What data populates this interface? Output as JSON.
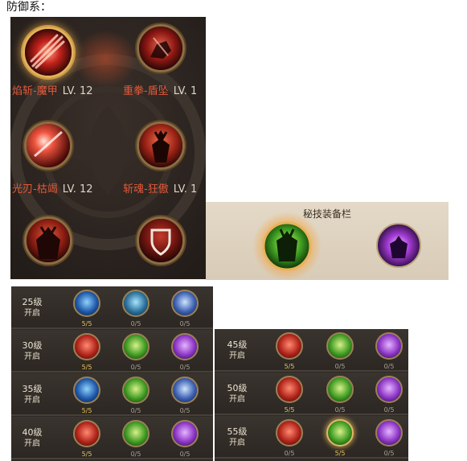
{
  "heading": "防御系：",
  "skills": [
    {
      "name": "焰斩-魔甲",
      "level": "LV. 12",
      "icon": "flame-slash-icon",
      "selected": true
    },
    {
      "name": "重拳-盾坠",
      "level": "LV. 1",
      "icon": "heavy-fist-icon",
      "selected": false
    },
    {
      "name": "光刃-枯竭",
      "level": "LV. 12",
      "icon": "light-blade-icon",
      "selected": false
    },
    {
      "name": "斩魂-狂傲",
      "level": "LV. 1",
      "icon": "soul-slash-icon",
      "selected": false
    },
    {
      "name": "",
      "level": "",
      "icon": "demon-figure-icon",
      "selected": false
    },
    {
      "name": "",
      "level": "",
      "icon": "shield-icon",
      "selected": false
    }
  ],
  "equip_bar": {
    "title": "秘技装备栏",
    "slots": [
      {
        "icon": "green-demon-icon",
        "active": true
      },
      {
        "icon": "purple-aura-icon",
        "active": false
      }
    ]
  },
  "level_tables": {
    "left": [
      {
        "level": "25级",
        "open": "开启",
        "counts": [
          "5/5",
          "0/5",
          "0/5"
        ],
        "icons": [
          "blue-swirl-icon",
          "teal-wave-icon",
          "hooded-figure-icon"
        ]
      },
      {
        "level": "30级",
        "open": "开启",
        "counts": [
          "5/5",
          "0/5",
          "0/5"
        ],
        "icons": [
          "red-mask-icon",
          "green-burst-icon",
          "purple-crystal-icon"
        ]
      },
      {
        "level": "35级",
        "open": "开启",
        "counts": [
          "5/5",
          "0/5",
          "0/5"
        ],
        "icons": [
          "blue-arm-icon",
          "green-fist-icon",
          "blue-hood-icon"
        ]
      },
      {
        "level": "40级",
        "open": "开启",
        "counts": [
          "5/5",
          "0/5",
          "0/5"
        ],
        "icons": [
          "red-orb-icon",
          "green-spike-icon",
          "purple-slash-icon"
        ]
      }
    ],
    "right": [
      {
        "level": "45级",
        "open": "开启",
        "counts": [
          "5/5",
          "0/5",
          "0/5"
        ],
        "icons": [
          "red-blade-icon",
          "green-figure-icon",
          "purple-figure-icon"
        ]
      },
      {
        "level": "50级",
        "open": "开启",
        "counts": [
          "5/5",
          "0/5",
          "0/5"
        ],
        "icons": [
          "red-claw-icon",
          "green-lunge-icon",
          "purple-kick-icon"
        ]
      },
      {
        "level": "55级",
        "open": "开启",
        "counts": [
          "0/5",
          "5/5",
          "0/5"
        ],
        "icons": [
          "red-demon-icon",
          "green-demon-icon",
          "purple-aura-icon"
        ],
        "gold": 1
      }
    ]
  },
  "colors": {
    "panel_bg": "#2b2522",
    "skill_name": "#e25a3a",
    "level_text": "#ded6c7",
    "count_full": "#e6c45a",
    "count_none": "#a7a095",
    "ring_gold": "#e3b867"
  }
}
